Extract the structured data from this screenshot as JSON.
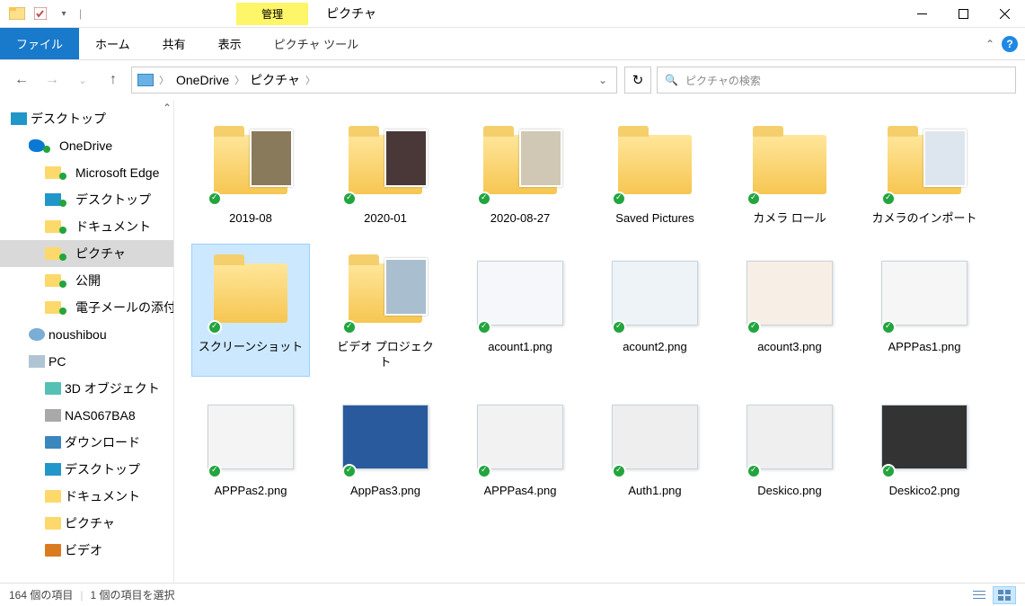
{
  "window": {
    "title": "ピクチャ",
    "context_tab_header": "管理",
    "context_tab_label": "ピクチャ ツール"
  },
  "ribbon": {
    "file": "ファイル",
    "home": "ホーム",
    "share": "共有",
    "view": "表示"
  },
  "breadcrumb": {
    "items": [
      "OneDrive",
      "ピクチャ"
    ]
  },
  "search": {
    "placeholder": "ピクチャの検索"
  },
  "tree": {
    "desktop": "デスクトップ",
    "onedrive": "OneDrive",
    "ms_edge": "Microsoft Edge",
    "desktop2": "デスクトップ",
    "documents": "ドキュメント",
    "pictures": "ピクチャ",
    "public": "公開",
    "emails": "電子メールの添付ファイル",
    "user": "noushibou",
    "pc": "PC",
    "3d": "3D オブジェクト",
    "nas": "NAS067BA8",
    "downloads": "ダウンロード",
    "desktop3": "デスクトップ",
    "documents2": "ドキュメント",
    "pictures2": "ピクチャ",
    "video": "ビデオ"
  },
  "items": [
    {
      "name": "2019-08",
      "type": "folder",
      "preview": "#8a7a5c"
    },
    {
      "name": "2020-01",
      "type": "folder",
      "preview": "#4a3838"
    },
    {
      "name": "2020-08-27",
      "type": "folder",
      "preview": "#d0c8b4"
    },
    {
      "name": "Saved Pictures",
      "type": "folder"
    },
    {
      "name": "カメラ ロール",
      "type": "folder"
    },
    {
      "name": "カメラのインポート",
      "type": "folder",
      "preview": "#dde6ee"
    },
    {
      "name": "スクリーンショット",
      "type": "folder",
      "selected": true
    },
    {
      "name": "ビデオ プロジェクト",
      "type": "folder",
      "preview": "#a9bfd0"
    },
    {
      "name": "acount1.png",
      "type": "image",
      "bg": "#f5f7fa"
    },
    {
      "name": "acount2.png",
      "type": "image",
      "bg": "#eef3f7"
    },
    {
      "name": "acount3.png",
      "type": "image",
      "bg": "#f7efe6"
    },
    {
      "name": "APPPas1.png",
      "type": "image",
      "bg": "#f6f6f6"
    },
    {
      "name": "APPPas2.png",
      "type": "image",
      "bg": "#f4f4f4"
    },
    {
      "name": "AppPas3.png",
      "type": "image",
      "bg": "#2a5a9e"
    },
    {
      "name": "APPPas4.png",
      "type": "image",
      "bg": "#f2f2f2"
    },
    {
      "name": "Auth1.png",
      "type": "image",
      "bg": "#eeeeee"
    },
    {
      "name": "Deskico.png",
      "type": "image",
      "bg": "#efefef"
    },
    {
      "name": "Deskico2.png",
      "type": "image",
      "bg": "#333333"
    }
  ],
  "status": {
    "count": "164 個の項目",
    "selection": "1 個の項目を選択"
  }
}
